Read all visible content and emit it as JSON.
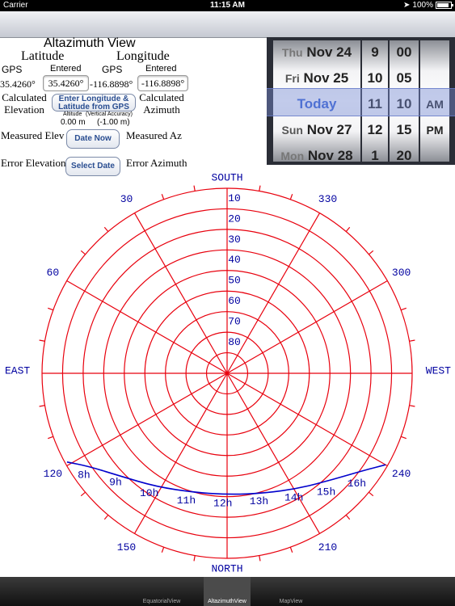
{
  "status_bar": {
    "carrier": "Carrier",
    "time": "11:15 AM",
    "battery": "100%",
    "battery_level": 1.0
  },
  "view_title": "Altazimuth View",
  "latitude": {
    "heading": "Latitude",
    "gps_label": "GPS",
    "entered_label": "Entered",
    "gps_value": "35.4260°",
    "entered_value": "35.4260°"
  },
  "longitude": {
    "heading": "Longitude",
    "gps_label": "GPS",
    "entered_label": "Entered",
    "gps_value": "-116.8898°",
    "entered_value": "-116.8898°"
  },
  "calc_elevation": "Calculated Elevation",
  "calc_azimuth": "Calculated Azimuth",
  "gps_button": "Enter Longitude & Latitude from GPS",
  "altitude": {
    "label1": "Altitude",
    "label2": "(Vertical Accuracy)",
    "value1": "0.00 m",
    "value2": "(-1.00 m)"
  },
  "measured_elev": "Measured Elev",
  "measured_az": "Measured Az",
  "error_elevation": "Error Elevation",
  "error_azimuth": "Error Azimuth",
  "date_now_button": "Date Now",
  "select_date_button": "Select Date",
  "picker": {
    "days": [
      {
        "wd": "Thu",
        "date": "Nov 24"
      },
      {
        "wd": "Fri",
        "date": "Nov 25"
      },
      {
        "wd": "",
        "date": "Today"
      },
      {
        "wd": "Sun",
        "date": "Nov 27"
      },
      {
        "wd": "Mon",
        "date": "Nov 28"
      }
    ],
    "hours": [
      "9",
      "10",
      "11",
      "12",
      "1"
    ],
    "minutes": [
      "00",
      "05",
      "10",
      "15",
      "20"
    ],
    "ampm": [
      "",
      "",
      "AM",
      "PM",
      ""
    ]
  },
  "polar": {
    "direction_labels": {
      "south": "SOUTH",
      "north": "NORTH",
      "east": "EAST",
      "west": "WEST"
    },
    "azimuth_labels": [
      "30",
      "60",
      "120",
      "150",
      "210",
      "240",
      "300",
      "330"
    ],
    "elevation_labels": [
      "10",
      "20",
      "30",
      "40",
      "50",
      "60",
      "70",
      "80"
    ],
    "hour_labels": [
      "8h",
      "9h",
      "10h",
      "11h",
      "12h",
      "13h",
      "14h",
      "15h",
      "16h"
    ]
  },
  "chart_data": {
    "type": "scatter",
    "projection": "polar-altazimuth",
    "elevation_ticks": [
      10,
      20,
      30,
      40,
      50,
      60,
      70,
      80
    ],
    "azimuth_ticks": [
      30,
      60,
      120,
      150,
      210,
      240,
      300,
      330
    ],
    "sun_path": [
      {
        "az": 119,
        "el": 1
      },
      {
        "az": 124,
        "el": 9
      },
      {
        "az": 134,
        "el": 18
      },
      {
        "az": 148,
        "el": 25
      },
      {
        "az": 165,
        "el": 30
      },
      {
        "az": 181,
        "el": 31
      },
      {
        "az": 197,
        "el": 29
      },
      {
        "az": 212,
        "el": 24
      },
      {
        "az": 225,
        "el": 17
      },
      {
        "az": 235,
        "el": 8
      },
      {
        "az": 240,
        "el": 1
      }
    ],
    "hour_markers": [
      {
        "label": "8h",
        "az": 123,
        "el": 7
      },
      {
        "label": "9h",
        "az": 132,
        "el": 17
      },
      {
        "label": "10h",
        "az": 145,
        "el": 24
      },
      {
        "label": "11h",
        "az": 161,
        "el": 29
      },
      {
        "label": "12h",
        "az": 178,
        "el": 31
      },
      {
        "label": "13h",
        "az": 195,
        "el": 30
      },
      {
        "label": "14h",
        "az": 210,
        "el": 25
      },
      {
        "label": "15h",
        "az": 222,
        "el": 18
      },
      {
        "label": "16h",
        "az": 232,
        "el": 10
      }
    ],
    "colors": {
      "grid": "#e8000d",
      "sun_path": "#0000cc",
      "labels": "#0000a0"
    }
  }
}
